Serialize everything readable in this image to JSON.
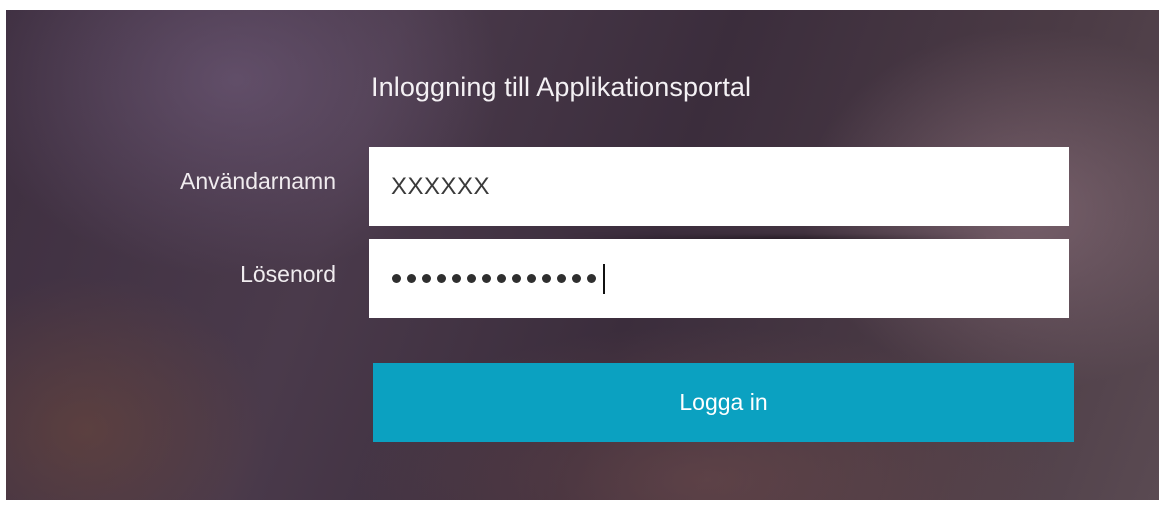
{
  "title": "Inloggning till Applikationsportal",
  "username": {
    "label": "Användarnamn",
    "value": "XXXXXX"
  },
  "password": {
    "label": "Lösenord",
    "masked_length": 14
  },
  "login_button": {
    "label": "Logga in"
  },
  "colors": {
    "button": "#0ba1c1",
    "field": "#ffffff",
    "text_on_dark": "#f0ecef"
  }
}
